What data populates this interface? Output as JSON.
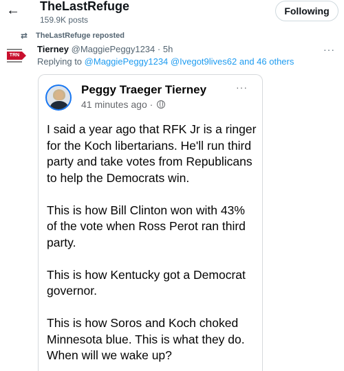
{
  "header": {
    "back_icon": "arrow-left-icon",
    "profile_name": "TheLastRefuge",
    "post_count": "159.9K posts",
    "following_label": "Following"
  },
  "repost": {
    "icon": "repost-icon",
    "text": "TheLastRefuge reposted"
  },
  "tweet": {
    "avatar_text": "TRN",
    "author_name": "Tierney",
    "author_handle": "@MaggiePeggy1234",
    "separator": "·",
    "time": "5h",
    "more": "···",
    "replying_prefix": "Replying to",
    "reply_handle_1": "@MaggiePeggy1234",
    "reply_handle_2": "@Ivegot9lives62",
    "reply_rest": "and 46 others"
  },
  "embedded_post": {
    "author": "Peggy Traeger Tierney",
    "time": "41 minutes ago ·",
    "globe_icon": "globe-icon",
    "more": "···",
    "paragraphs": [
      "I said a year ago that RFK Jr is a ringer for the Koch libertarians. He'll run third party and take votes from Republicans to help the Democrats win.",
      "This is how Bill Clinton won with 43% of the vote when Ross Perot ran third party.",
      "This is how Kentucky got a Democrat governor.",
      "This is how Soros and Koch choked Minnesota blue. This is what they do. When will we wake up?"
    ]
  },
  "colors": {
    "link": "#1d9bf0",
    "secondary_text": "#536471",
    "badge_red": "#c8102e"
  }
}
